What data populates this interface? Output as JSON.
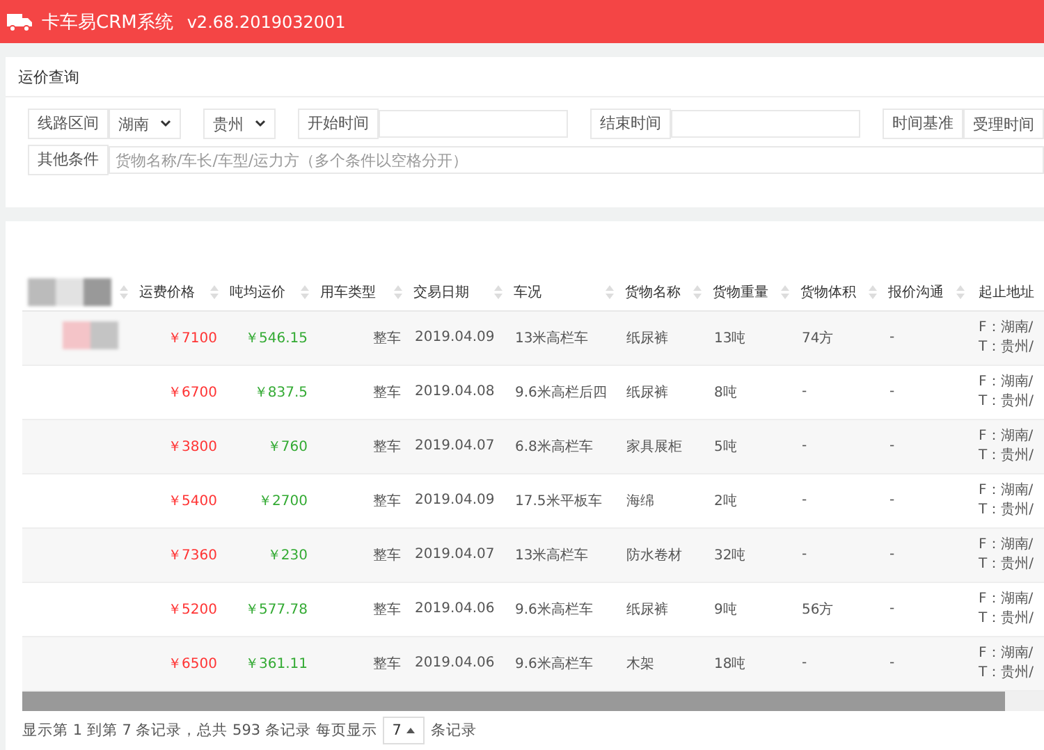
{
  "header": {
    "app_name": "卡车易CRM系统",
    "version": "v2.68.2019032001"
  },
  "query": {
    "title": "运价查询",
    "route": {
      "label": "线路区间",
      "from": "湖南",
      "to": "贵州"
    },
    "start_time": {
      "label": "开始时间"
    },
    "end_time": {
      "label": "结束时间"
    },
    "time_basis": {
      "label": "时间基准",
      "value": "受理时间"
    },
    "other": {
      "label": "其他条件",
      "placeholder": "货物名称/车长/车型/运力方（多个条件以空格分开）"
    }
  },
  "table": {
    "columns": [
      "运费价格",
      "吨均运价",
      "用车类型",
      "交易日期",
      "车况",
      "货物名称",
      "货物重量",
      "货物体积",
      "报价沟通",
      "起止地址"
    ],
    "rows": [
      {
        "price": "￥7100",
        "avg": "￥546.15",
        "type": "整车",
        "date": "2019.04.09",
        "vehicle": "13米高栏车",
        "goods": "纸尿裤",
        "weight": "13吨",
        "volume": "74方",
        "quote": "-",
        "from": "F：湖南/",
        "to": "T：贵州/"
      },
      {
        "price": "￥6700",
        "avg": "￥837.5",
        "type": "整车",
        "date": "2019.04.08",
        "vehicle": "9.6米高栏后四",
        "goods": "纸尿裤",
        "weight": "8吨",
        "volume": "-",
        "quote": "-",
        "from": "F：湖南/",
        "to": "T：贵州/"
      },
      {
        "price": "￥3800",
        "avg": "￥760",
        "type": "整车",
        "date": "2019.04.07",
        "vehicle": "6.8米高栏车",
        "goods": "家具展柜",
        "weight": "5吨",
        "volume": "-",
        "quote": "-",
        "from": "F：湖南/",
        "to": "T：贵州/"
      },
      {
        "price": "￥5400",
        "avg": "￥2700",
        "type": "整车",
        "date": "2019.04.09",
        "vehicle": "17.5米平板车",
        "goods": "海绵",
        "weight": "2吨",
        "volume": "-",
        "quote": "-",
        "from": "F：湖南/",
        "to": "T：贵州/"
      },
      {
        "price": "￥7360",
        "avg": "￥230",
        "type": "整车",
        "date": "2019.04.07",
        "vehicle": "13米高栏车",
        "goods": "防水卷材",
        "weight": "32吨",
        "volume": "-",
        "quote": "-",
        "from": "F：湖南/",
        "to": "T：贵州/"
      },
      {
        "price": "￥5200",
        "avg": "￥577.78",
        "type": "整车",
        "date": "2019.04.06",
        "vehicle": "9.6米高栏车",
        "goods": "纸尿裤",
        "weight": "9吨",
        "volume": "56方",
        "quote": "-",
        "from": "F：湖南/",
        "to": "T：贵州/"
      },
      {
        "price": "￥6500",
        "avg": "￥361.11",
        "type": "整车",
        "date": "2019.04.06",
        "vehicle": "9.6米高栏车",
        "goods": "木架",
        "weight": "18吨",
        "volume": "-",
        "quote": "-",
        "from": "F：湖南/",
        "to": "T：贵州/"
      }
    ]
  },
  "footer": {
    "summary": "显示第 1 到第 7 条记录，总共 593 条记录 每页显示",
    "page_size": "7",
    "suffix": "条记录"
  }
}
